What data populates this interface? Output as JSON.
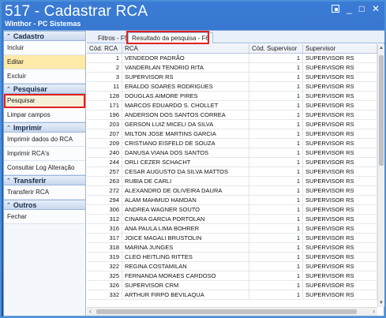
{
  "window": {
    "title": "517 - Cadastrar RCA",
    "subtitle": "Winthor - PC Sistemas",
    "buttons": {
      "restore": "",
      "minimize": "_",
      "maximize": "□",
      "close": "✕"
    }
  },
  "sidebar": {
    "groups": [
      {
        "title": "Cadastro",
        "items": [
          "Incluir",
          "Editar",
          "Excluir"
        ]
      },
      {
        "title": "Pesquisar",
        "items": [
          "Pesquisar",
          "Limpar campos"
        ]
      },
      {
        "title": "Imprimir",
        "items": [
          "Imprimir dados do RCA",
          "Imprimir RCA's",
          "Consultar Log Alteração"
        ]
      },
      {
        "title": "Transferir",
        "items": [
          "Transferir RCA"
        ]
      },
      {
        "title": "Outros",
        "items": [
          "Fechar"
        ]
      }
    ]
  },
  "tabs": [
    "Filtros - F5",
    "Resultado da pesquisa - F6"
  ],
  "grid": {
    "columns": [
      "Cód. RCA",
      "RCA",
      "Cód. Supervisor",
      "Supervisor"
    ],
    "rows": [
      [
        "1",
        "VENDEDOR PADRÃO",
        "1",
        "SUPERVISOR RS"
      ],
      [
        "2",
        "VANDERLAN TENORIO RITA",
        "1",
        "SUPERVISOR RS"
      ],
      [
        "3",
        "SUPERVISOR RS",
        "1",
        "SUPERVISOR RS"
      ],
      [
        "11",
        "ERALDO SOARES RODRIGUES",
        "1",
        "SUPERVISOR RS"
      ],
      [
        "128",
        "DOUGLAS AIMORE PIRES",
        "1",
        "SUPERVISOR RS"
      ],
      [
        "171",
        "MARCOS EDUARDO S. CHOLLET",
        "1",
        "SUPERVISOR RS"
      ],
      [
        "196",
        "ANDERSON DOS SANTOS CORREA",
        "1",
        "SUPERVISOR RS"
      ],
      [
        "203",
        "GERSON LUIZ MICELI DA SILVA",
        "1",
        "SUPERVISOR RS"
      ],
      [
        "207",
        "MILTON JOSE MARTINS GARCIA",
        "1",
        "SUPERVISOR RS"
      ],
      [
        "209",
        "CRISTIANO EISFELD DE SOUZA",
        "1",
        "SUPERVISOR RS"
      ],
      [
        "240",
        "DANUSA VIANA DOS SANTOS",
        "1",
        "SUPERVISOR RS"
      ],
      [
        "244",
        "ORLI CEZER SCHACHT",
        "1",
        "SUPERVISOR RS"
      ],
      [
        "257",
        "CESAR AUGUSTO DA SILVA MATTOS",
        "1",
        "SUPERVISOR RS"
      ],
      [
        "263",
        "RUBIA DE CARLI",
        "1",
        "SUPERVISOR RS"
      ],
      [
        "272",
        "ALEXANDRO DE OLIVEIRA DAURA",
        "1",
        "SUPERVISOR RS"
      ],
      [
        "294",
        "ALAM MAHMUD HAMDAN",
        "1",
        "SUPERVISOR RS"
      ],
      [
        "306",
        "ANDREA WAGNER SOUTO",
        "1",
        "SUPERVISOR RS"
      ],
      [
        "312",
        "CINARA GARCIA PORTOLAN",
        "1",
        "SUPERVISOR RS"
      ],
      [
        "316",
        "ANA PAULA LIMA BOHRER",
        "1",
        "SUPERVISOR RS"
      ],
      [
        "317",
        "JOICE MAGALI BRUSTOLIN",
        "1",
        "SUPERVISOR RS"
      ],
      [
        "318",
        "MARINA JUNGES",
        "1",
        "SUPERVISOR RS"
      ],
      [
        "319",
        "CLEO HEITLING RITTES",
        "1",
        "SUPERVISOR RS"
      ],
      [
        "322",
        "REGINA COSTAMILAN",
        "1",
        "SUPERVISOR RS"
      ],
      [
        "325",
        "FERNANDA MORAES CARDOSO",
        "1",
        "SUPERVISOR RS"
      ],
      [
        "326",
        "SUPERVISOR CRM",
        "1",
        "SUPERVISOR RS"
      ],
      [
        "332",
        "ARTHUR FIRPO BEVILAQUA",
        "1",
        "SUPERVISOR RS"
      ]
    ]
  },
  "colors": {
    "accent": "#2a63b8",
    "highlight": "#e02020",
    "selected": "#fde9a8"
  },
  "icons": {
    "group": "chevron-up-icon"
  }
}
